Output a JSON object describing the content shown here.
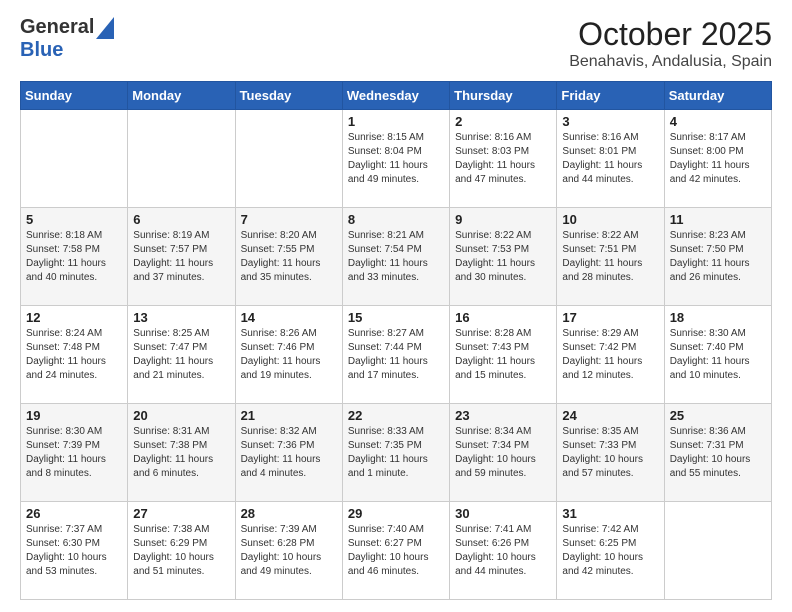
{
  "header": {
    "logo_general": "General",
    "logo_blue": "Blue",
    "title": "October 2025",
    "subtitle": "Benahavis, Andalusia, Spain"
  },
  "calendar": {
    "days_of_week": [
      "Sunday",
      "Monday",
      "Tuesday",
      "Wednesday",
      "Thursday",
      "Friday",
      "Saturday"
    ],
    "weeks": [
      [
        {
          "day": "",
          "info": ""
        },
        {
          "day": "",
          "info": ""
        },
        {
          "day": "",
          "info": ""
        },
        {
          "day": "1",
          "info": "Sunrise: 8:15 AM\nSunset: 8:04 PM\nDaylight: 11 hours\nand 49 minutes."
        },
        {
          "day": "2",
          "info": "Sunrise: 8:16 AM\nSunset: 8:03 PM\nDaylight: 11 hours\nand 47 minutes."
        },
        {
          "day": "3",
          "info": "Sunrise: 8:16 AM\nSunset: 8:01 PM\nDaylight: 11 hours\nand 44 minutes."
        },
        {
          "day": "4",
          "info": "Sunrise: 8:17 AM\nSunset: 8:00 PM\nDaylight: 11 hours\nand 42 minutes."
        }
      ],
      [
        {
          "day": "5",
          "info": "Sunrise: 8:18 AM\nSunset: 7:58 PM\nDaylight: 11 hours\nand 40 minutes."
        },
        {
          "day": "6",
          "info": "Sunrise: 8:19 AM\nSunset: 7:57 PM\nDaylight: 11 hours\nand 37 minutes."
        },
        {
          "day": "7",
          "info": "Sunrise: 8:20 AM\nSunset: 7:55 PM\nDaylight: 11 hours\nand 35 minutes."
        },
        {
          "day": "8",
          "info": "Sunrise: 8:21 AM\nSunset: 7:54 PM\nDaylight: 11 hours\nand 33 minutes."
        },
        {
          "day": "9",
          "info": "Sunrise: 8:22 AM\nSunset: 7:53 PM\nDaylight: 11 hours\nand 30 minutes."
        },
        {
          "day": "10",
          "info": "Sunrise: 8:22 AM\nSunset: 7:51 PM\nDaylight: 11 hours\nand 28 minutes."
        },
        {
          "day": "11",
          "info": "Sunrise: 8:23 AM\nSunset: 7:50 PM\nDaylight: 11 hours\nand 26 minutes."
        }
      ],
      [
        {
          "day": "12",
          "info": "Sunrise: 8:24 AM\nSunset: 7:48 PM\nDaylight: 11 hours\nand 24 minutes."
        },
        {
          "day": "13",
          "info": "Sunrise: 8:25 AM\nSunset: 7:47 PM\nDaylight: 11 hours\nand 21 minutes."
        },
        {
          "day": "14",
          "info": "Sunrise: 8:26 AM\nSunset: 7:46 PM\nDaylight: 11 hours\nand 19 minutes."
        },
        {
          "day": "15",
          "info": "Sunrise: 8:27 AM\nSunset: 7:44 PM\nDaylight: 11 hours\nand 17 minutes."
        },
        {
          "day": "16",
          "info": "Sunrise: 8:28 AM\nSunset: 7:43 PM\nDaylight: 11 hours\nand 15 minutes."
        },
        {
          "day": "17",
          "info": "Sunrise: 8:29 AM\nSunset: 7:42 PM\nDaylight: 11 hours\nand 12 minutes."
        },
        {
          "day": "18",
          "info": "Sunrise: 8:30 AM\nSunset: 7:40 PM\nDaylight: 11 hours\nand 10 minutes."
        }
      ],
      [
        {
          "day": "19",
          "info": "Sunrise: 8:30 AM\nSunset: 7:39 PM\nDaylight: 11 hours\nand 8 minutes."
        },
        {
          "day": "20",
          "info": "Sunrise: 8:31 AM\nSunset: 7:38 PM\nDaylight: 11 hours\nand 6 minutes."
        },
        {
          "day": "21",
          "info": "Sunrise: 8:32 AM\nSunset: 7:36 PM\nDaylight: 11 hours\nand 4 minutes."
        },
        {
          "day": "22",
          "info": "Sunrise: 8:33 AM\nSunset: 7:35 PM\nDaylight: 11 hours\nand 1 minute."
        },
        {
          "day": "23",
          "info": "Sunrise: 8:34 AM\nSunset: 7:34 PM\nDaylight: 10 hours\nand 59 minutes."
        },
        {
          "day": "24",
          "info": "Sunrise: 8:35 AM\nSunset: 7:33 PM\nDaylight: 10 hours\nand 57 minutes."
        },
        {
          "day": "25",
          "info": "Sunrise: 8:36 AM\nSunset: 7:31 PM\nDaylight: 10 hours\nand 55 minutes."
        }
      ],
      [
        {
          "day": "26",
          "info": "Sunrise: 7:37 AM\nSunset: 6:30 PM\nDaylight: 10 hours\nand 53 minutes."
        },
        {
          "day": "27",
          "info": "Sunrise: 7:38 AM\nSunset: 6:29 PM\nDaylight: 10 hours\nand 51 minutes."
        },
        {
          "day": "28",
          "info": "Sunrise: 7:39 AM\nSunset: 6:28 PM\nDaylight: 10 hours\nand 49 minutes."
        },
        {
          "day": "29",
          "info": "Sunrise: 7:40 AM\nSunset: 6:27 PM\nDaylight: 10 hours\nand 46 minutes."
        },
        {
          "day": "30",
          "info": "Sunrise: 7:41 AM\nSunset: 6:26 PM\nDaylight: 10 hours\nand 44 minutes."
        },
        {
          "day": "31",
          "info": "Sunrise: 7:42 AM\nSunset: 6:25 PM\nDaylight: 10 hours\nand 42 minutes."
        },
        {
          "day": "",
          "info": ""
        }
      ]
    ]
  }
}
